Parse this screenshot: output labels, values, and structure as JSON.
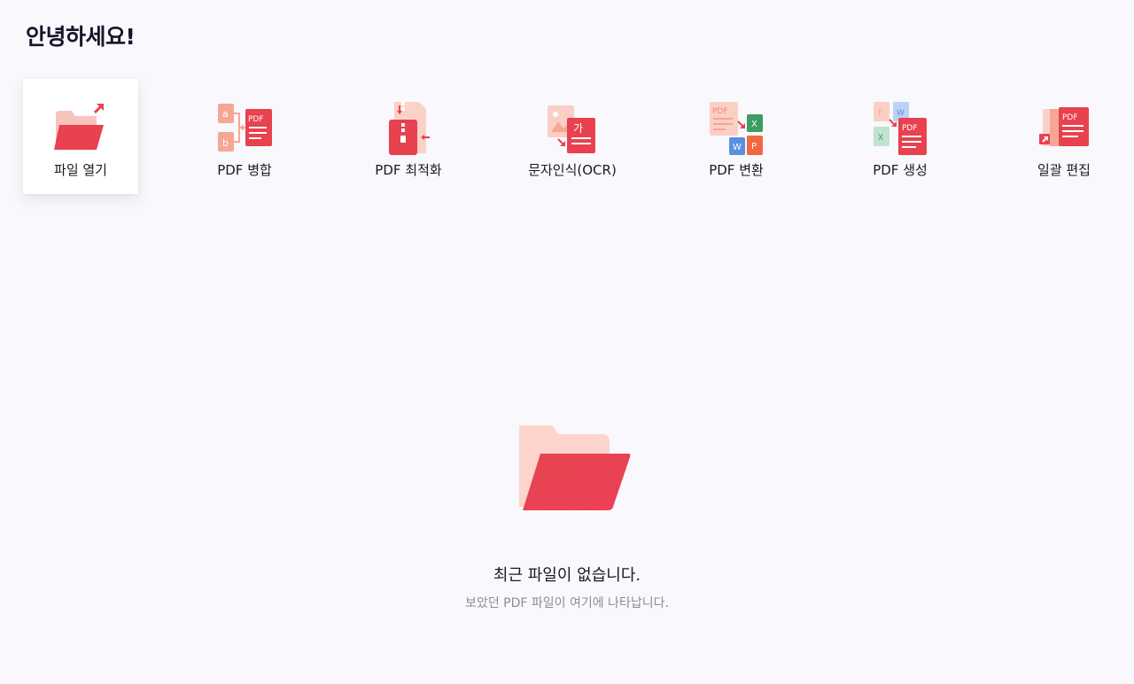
{
  "header": {
    "greeting": "안녕하세요!"
  },
  "colors": {
    "accent": "#e8414f",
    "accent_light": "#f8c4bb",
    "background": "#f9f8fc"
  },
  "tools": [
    {
      "label": "파일 열기",
      "icon": "open-folder-icon",
      "active": true
    },
    {
      "label": "PDF 병합",
      "icon": "merge-pdf-icon"
    },
    {
      "label": "PDF 최적화",
      "icon": "compress-pdf-icon"
    },
    {
      "label": "문자인식(OCR)",
      "icon": "ocr-icon"
    },
    {
      "label": "PDF 변환",
      "icon": "convert-pdf-icon"
    },
    {
      "label": "PDF 생성",
      "icon": "create-pdf-icon"
    },
    {
      "label": "일괄 편집",
      "icon": "batch-edit-icon"
    }
  ],
  "recent": {
    "empty_title": "최근 파일이 없습니다.",
    "empty_subtitle": "보았던 PDF 파일이 여기에 나타납니다.",
    "icon": "empty-folder-icon"
  },
  "icon_text": {
    "pdf": "PDF",
    "a": "a",
    "b": "b",
    "ga": "가",
    "x": "X",
    "w": "W",
    "p": "P"
  }
}
